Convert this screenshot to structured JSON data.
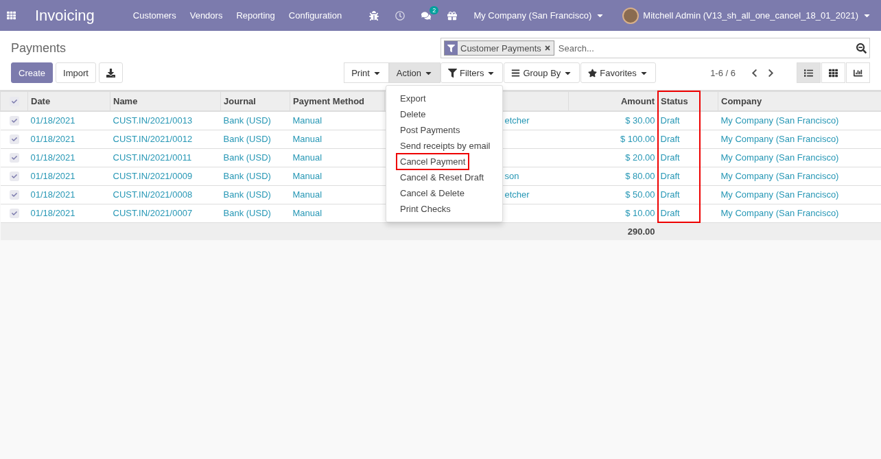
{
  "navbar": {
    "app_title": "Invoicing",
    "menu": [
      "Customers",
      "Vendors",
      "Reporting",
      "Configuration"
    ],
    "message_count": "2",
    "company": "My Company (San Francisco)",
    "user": "Mitchell Admin (V13_sh_all_one_cancel_18_01_2021)"
  },
  "control_panel": {
    "title": "Payments",
    "buttons": [
      {
        "label": "Create",
        "kind": "primary"
      },
      {
        "label": "Import",
        "kind": "secondary"
      },
      {
        "kind": "download"
      }
    ],
    "search": {
      "facet": "Customer Payments",
      "placeholder": "Search..."
    },
    "sidebar_buttons": [
      {
        "label": "Print",
        "selected": false
      },
      {
        "label": "Action",
        "selected": true
      }
    ],
    "search_buttons": [
      {
        "label": "Filters",
        "kind": "filter"
      },
      {
        "label": "Group By",
        "kind": "group"
      },
      {
        "label": "Favorites",
        "kind": "star"
      }
    ],
    "pager": "1-6 / 6",
    "views": [
      {
        "kind": "list",
        "selected": true
      },
      {
        "kind": "kanban",
        "selected": false
      },
      {
        "kind": "graph",
        "selected": false
      }
    ]
  },
  "action_menu": [
    {
      "label": "Export",
      "highlighted": false
    },
    {
      "label": "Delete",
      "highlighted": false
    },
    {
      "label": "Post Payments",
      "highlighted": false
    },
    {
      "label": "Send receipts by email",
      "highlighted": false
    },
    {
      "label": "Cancel Payment",
      "highlighted": true
    },
    {
      "label": "Cancel & Reset Draft",
      "highlighted": false
    },
    {
      "label": "Cancel & Delete",
      "highlighted": false
    },
    {
      "label": "Print Checks",
      "highlighted": false
    }
  ],
  "table": {
    "header_checked": true,
    "columns": [
      {
        "label": "Date",
        "highlighted": false
      },
      {
        "label": "Name",
        "highlighted": false
      },
      {
        "label": "Journal",
        "highlighted": false
      },
      {
        "label": "Payment Method",
        "highlighted": false
      },
      {
        "label": "Amount",
        "highlighted": false
      },
      {
        "label": "Status",
        "highlighted": true
      },
      {
        "label": "Company",
        "highlighted": false
      }
    ],
    "rows": [
      {
        "checked": true,
        "covered_text": "etcher",
        "cells": [
          "01/18/2021",
          "CUST.IN/2021/0013",
          "Bank (USD)",
          "Manual",
          "$ 30.00",
          "Draft",
          "My Company (San Francisco)"
        ]
      },
      {
        "checked": true,
        "cells": [
          "01/18/2021",
          "CUST.IN/2021/0012",
          "Bank (USD)",
          "Manual",
          "$ 100.00",
          "Draft",
          "My Company (San Francisco)"
        ]
      },
      {
        "checked": true,
        "cells": [
          "01/18/2021",
          "CUST.IN/2021/0011",
          "Bank (USD)",
          "Manual",
          "$ 20.00",
          "Draft",
          "My Company (San Francisco)"
        ]
      },
      {
        "checked": true,
        "covered_text": "son",
        "cells": [
          "01/18/2021",
          "CUST.IN/2021/0009",
          "Bank (USD)",
          "Manual",
          "$ 80.00",
          "Draft",
          "My Company (San Francisco)"
        ]
      },
      {
        "checked": true,
        "covered_text": "etcher",
        "cells": [
          "01/18/2021",
          "CUST.IN/2021/0008",
          "Bank (USD)",
          "Manual",
          "$ 50.00",
          "Draft",
          "My Company (San Francisco)"
        ]
      },
      {
        "checked": true,
        "cells": [
          "01/18/2021",
          "CUST.IN/2021/0007",
          "Bank (USD)",
          "Manual",
          "$ 10.00",
          "Draft",
          "My Company (San Francisco)"
        ]
      }
    ],
    "total": "290.00"
  }
}
